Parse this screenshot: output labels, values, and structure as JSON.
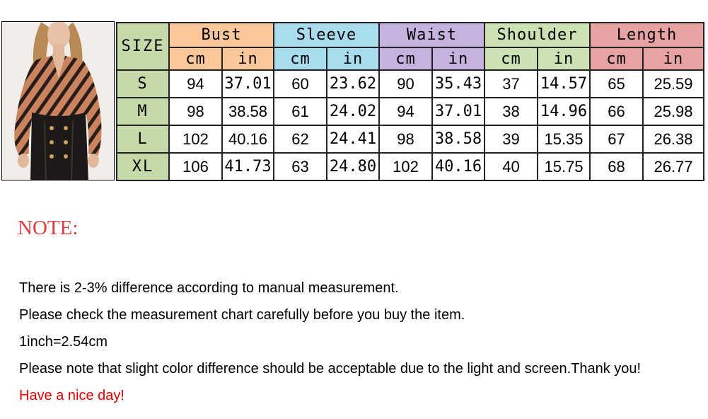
{
  "colors": {
    "size": "#c5d9a9",
    "bust": "#f9c79a",
    "sleeve": "#a9dcef",
    "waist": "#c5b2de",
    "shoulder": "#cde2b4",
    "length": "#e9a2a3",
    "note_title": "#e03c3c",
    "red_text": "#e00000"
  },
  "table": {
    "size_label": "SIZE",
    "groups": [
      "Bust",
      "Sleeve",
      "Waist",
      "Shoulder",
      "Length"
    ],
    "units": [
      "cm",
      "in",
      "cm",
      "in",
      "cm",
      "in",
      "cm",
      "in",
      "cm",
      "in"
    ],
    "rows": [
      [
        "S",
        "94",
        "37.01",
        "60",
        "23.62",
        "90",
        "35.43",
        "37",
        "14.57",
        "65",
        "25.59"
      ],
      [
        "M",
        "98",
        "38.58",
        "61",
        "24.02",
        "94",
        "37.01",
        "38",
        "14.96",
        "66",
        "25.98"
      ],
      [
        "L",
        "102",
        "40.16",
        "62",
        "24.41",
        "98",
        "38.58",
        "39",
        "15.35",
        "67",
        "26.38"
      ],
      [
        "XL",
        "106",
        "41.73",
        "63",
        "24.80",
        "102",
        "40.16",
        "40",
        "15.75",
        "68",
        "26.77"
      ]
    ]
  },
  "note": {
    "title": "NOTE:",
    "lines": [
      "There is 2-3% difference according to manual measurement.",
      "Please check the measurement chart carefully before you buy the item.",
      "1inch=2.54cm",
      "Please note that slight color difference should be acceptable due to the light and screen.Thank you!",
      "Have a nice day!"
    ]
  }
}
